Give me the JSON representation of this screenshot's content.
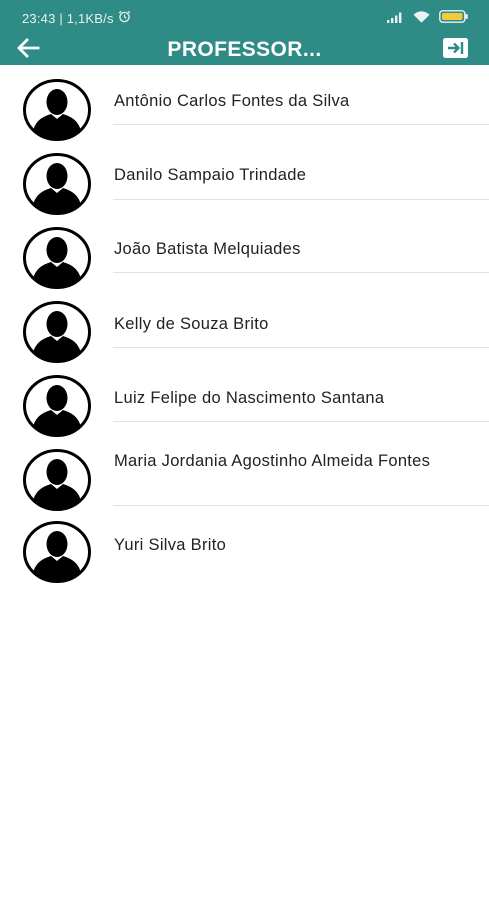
{
  "status_bar": {
    "time_speed": "23:43 | 1,1KB/s",
    "alarm_icon": "alarm-clock-icon",
    "signal_icon": "cell-signal-icon",
    "wifi_icon": "wifi-icon",
    "battery_icon": "battery-icon"
  },
  "app_bar": {
    "title": "PROFESSOR...",
    "back_icon": "arrow-left-icon",
    "logout_icon": "logout-icon"
  },
  "colors": {
    "primary": "#2e8b85",
    "avatar": "#000000",
    "divider": "#e2e2e2"
  },
  "professors": [
    {
      "name": "Antônio Carlos Fontes da Silva"
    },
    {
      "name": "Danilo Sampaio Trindade"
    },
    {
      "name": "João Batista Melquiades"
    },
    {
      "name": "Kelly de Souza Brito"
    },
    {
      "name": "Luiz Felipe do Nascimento Santana"
    },
    {
      "name": "Maria Jordania Agostinho Almeida Fontes"
    },
    {
      "name": "Yuri Silva Brito"
    }
  ]
}
